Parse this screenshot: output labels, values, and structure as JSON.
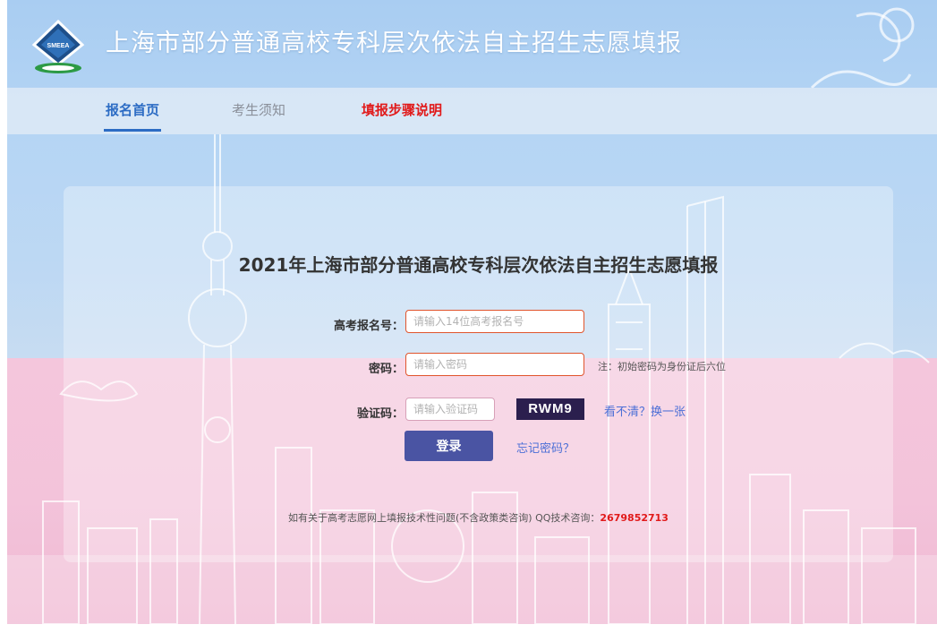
{
  "header": {
    "site_title": "上海市部分普通高校专科层次依法自主招生志愿填报",
    "logo_text": "SMEEA"
  },
  "nav": {
    "items": [
      {
        "label": "报名首页"
      },
      {
        "label": "考生须知"
      },
      {
        "label": "填报步骤说明"
      }
    ]
  },
  "login": {
    "title": "2021年上海市部分普通高校专科层次依法自主招生志愿填报",
    "exam_id_label": "高考报名号：",
    "exam_id_placeholder": "请输入14位高考报名号",
    "password_label": "密码：",
    "password_placeholder": "请输入密码",
    "password_hint": "注：初始密码为身份证后六位",
    "captcha_label": "验证码：",
    "captcha_placeholder": "请输入验证码",
    "captcha_text": "RWM9",
    "refresh_label": "看不清？换一张",
    "login_button": "登录",
    "forgot_label": "忘记密码？"
  },
  "footer": {
    "note": "如有关于高考志愿网上填报技术性问题(不含政策类咨询)  QQ技术咨询：",
    "qq": "2679852713"
  },
  "colors": {
    "accent": "#2c6cc4",
    "nav_alert": "#e11a1a",
    "button": "#4a54a3",
    "link": "#4c6fd6"
  }
}
